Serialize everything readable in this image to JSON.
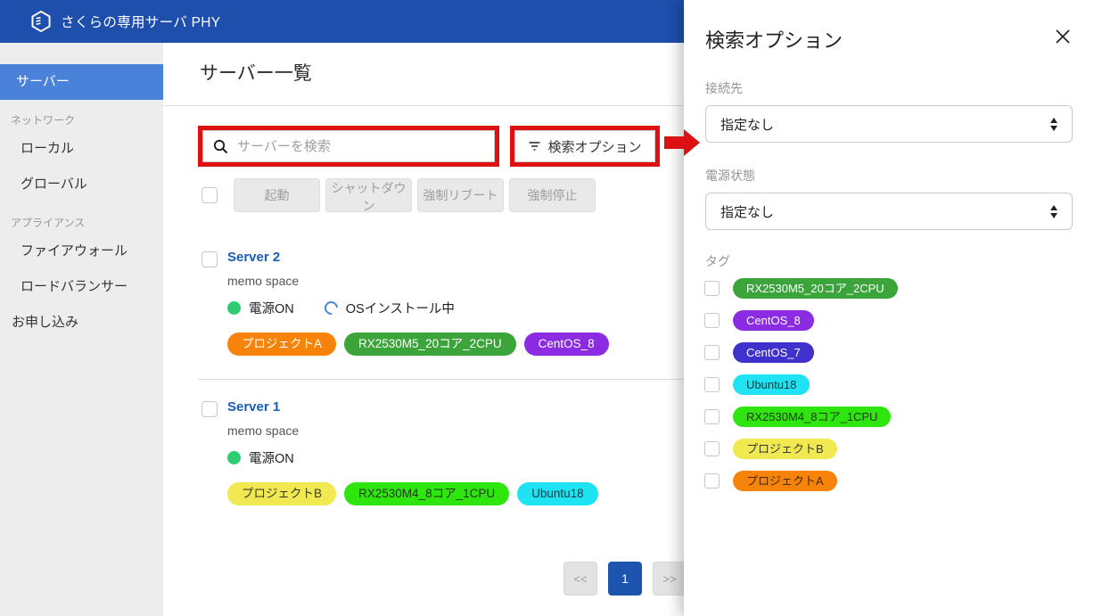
{
  "navbar": {
    "brand": "さくらの専用サーバ PHY"
  },
  "sidebar": {
    "items": [
      {
        "key": "server",
        "label": "サーバー",
        "type": "item",
        "selected": true
      },
      {
        "key": "network-section",
        "label": "ネットワーク",
        "type": "section"
      },
      {
        "key": "local",
        "label": "ローカル",
        "type": "subitem"
      },
      {
        "key": "global",
        "label": "グローバル",
        "type": "subitem"
      },
      {
        "key": "appliance-section",
        "label": "アプライアンス",
        "type": "section"
      },
      {
        "key": "firewall",
        "label": "ファイアウォール",
        "type": "subitem"
      },
      {
        "key": "load-balancer",
        "label": "ロードバランサー",
        "type": "subitem"
      },
      {
        "key": "application",
        "label": "お申し込み",
        "type": "item"
      }
    ]
  },
  "main": {
    "title": "サーバー一覧",
    "search": {
      "placeholder": "サーバーを検索",
      "icon": "search-icon"
    },
    "search_options_button": {
      "label": "検索オプション",
      "icon": "filter-icon"
    },
    "actions": [
      {
        "key": "start",
        "label": "起動"
      },
      {
        "key": "shutdown",
        "label": "シャットダウン"
      },
      {
        "key": "force-reboot",
        "label": "強制リブート"
      },
      {
        "key": "force-stop",
        "label": "強制停止"
      }
    ],
    "servers": [
      {
        "name": "Server 2",
        "memo": "memo space",
        "power_status": "電源ON",
        "installing_status": "OSインストール中",
        "tags": [
          {
            "label": "プロジェクトA",
            "bg": "#f8830a",
            "fg": "#ffffff"
          },
          {
            "label": "RX2530M5_20コア_2CPU",
            "bg": "#3ba43b",
            "fg": "#ffffff"
          },
          {
            "label": "CentOS_8",
            "bg": "#8b2be2",
            "fg": "#ffffff"
          }
        ]
      },
      {
        "name": "Server 1",
        "memo": "memo space",
        "power_status": "電源ON",
        "installing_status": null,
        "tags": [
          {
            "label": "プロジェクトB",
            "bg": "#f0e952",
            "fg": "#3a3a2a"
          },
          {
            "label": "RX2530M4_8コア_1CPU",
            "bg": "#2ee60e",
            "fg": "#223a1a"
          },
          {
            "label": "Ubuntu18",
            "bg": "#1fe2f2",
            "fg": "#173a3e"
          }
        ]
      }
    ],
    "pagination": {
      "prev": "<<",
      "current": "1",
      "next": ">>"
    }
  },
  "panel": {
    "title": "検索オプション",
    "close_icon": "close-icon",
    "fields": [
      {
        "key": "connection",
        "label": "接続先",
        "value": "指定なし"
      },
      {
        "key": "power-state",
        "label": "電源状態",
        "value": "指定なし"
      }
    ],
    "tags_label": "タグ",
    "tags": [
      {
        "label": "RX2530M5_20コア_2CPU",
        "bg": "#3ba43b",
        "fg": "#ffffff"
      },
      {
        "label": "CentOS_8",
        "bg": "#8b2be2",
        "fg": "#ffffff"
      },
      {
        "label": "CentOS_7",
        "bg": "#3e31cc",
        "fg": "#ffffff"
      },
      {
        "label": "Ubuntu18",
        "bg": "#1fe2f2",
        "fg": "#173a3e"
      },
      {
        "label": "RX2530M4_8コア_1CPU",
        "bg": "#2ee60e",
        "fg": "#223a1a"
      },
      {
        "label": "プロジェクトB",
        "bg": "#f0e952",
        "fg": "#3a3a2a"
      },
      {
        "label": "プロジェクトA",
        "bg": "#f8830a",
        "fg": "#4a2a00"
      }
    ]
  },
  "colors": {
    "navbar": "#1e4fad",
    "sidebar_selected": "#4a82da",
    "annotation_red": "#dd1111",
    "power_on_green": "#2ecc71",
    "active_page_blue": "#1d55ae"
  }
}
